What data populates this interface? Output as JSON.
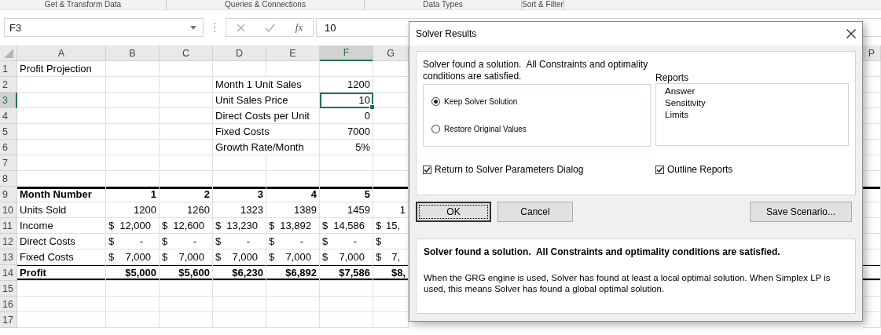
{
  "ribbon": {
    "groups": [
      "Get & Transform Data",
      "Queries & Connections",
      "Data Types",
      "Sort & Filter"
    ]
  },
  "formula_bar": {
    "name_box": "F3",
    "fx": "fx",
    "value": "10"
  },
  "sheet": {
    "columns": [
      {
        "label": "A",
        "selected": false
      },
      {
        "label": "B",
        "selected": false
      },
      {
        "label": "C",
        "selected": false
      },
      {
        "label": "D",
        "selected": false
      },
      {
        "label": "E",
        "selected": false
      },
      {
        "label": "F",
        "selected": true
      },
      {
        "label": "G",
        "selected": false
      },
      {
        "label": "P",
        "selected": false
      }
    ],
    "rows": [
      {
        "label": "1",
        "selected": false,
        "kind": "plain",
        "cells": [
          "Profit Projection"
        ]
      },
      {
        "label": "2",
        "selected": false,
        "kind": "plain",
        "cells": [
          null,
          null,
          null,
          "Month 1 Unit Sales",
          null,
          {
            "kind": "number",
            "text": "1200"
          }
        ]
      },
      {
        "label": "3",
        "selected": true,
        "kind": "plain",
        "cells": [
          null,
          null,
          null,
          "Unit Sales Price",
          null,
          {
            "kind": "number",
            "text": "10"
          }
        ]
      },
      {
        "label": "4",
        "selected": false,
        "kind": "plain",
        "cells": [
          null,
          null,
          null,
          "Direct Costs per Unit",
          null,
          {
            "kind": "number",
            "text": "0"
          }
        ]
      },
      {
        "label": "5",
        "selected": false,
        "kind": "plain",
        "cells": [
          null,
          null,
          null,
          "Fixed Costs",
          null,
          {
            "kind": "number",
            "text": "7000"
          }
        ]
      },
      {
        "label": "6",
        "selected": false,
        "kind": "plain",
        "cells": [
          null,
          null,
          null,
          "Growth Rate/Month",
          null,
          {
            "kind": "number",
            "text": "5%"
          }
        ]
      },
      {
        "label": "7",
        "selected": false,
        "kind": "plain",
        "cells": []
      },
      {
        "label": "8",
        "selected": false,
        "kind": "plain",
        "cells": []
      },
      {
        "label": "9",
        "selected": false,
        "kind": "header",
        "cells": [
          "Month Number",
          {
            "kind": "number",
            "text": "1"
          },
          {
            "kind": "number",
            "text": "2"
          },
          {
            "kind": "number",
            "text": "3"
          },
          {
            "kind": "number",
            "text": "4"
          },
          {
            "kind": "number",
            "text": "5"
          }
        ]
      },
      {
        "label": "10",
        "selected": false,
        "kind": "plain",
        "cells": [
          "Units Sold",
          {
            "kind": "number",
            "text": "1200"
          },
          {
            "kind": "number",
            "text": "1260"
          },
          {
            "kind": "number",
            "text": "1323"
          },
          {
            "kind": "number",
            "text": "1389"
          },
          {
            "kind": "number",
            "text": "1459"
          },
          {
            "kind": "number",
            "text": "1"
          }
        ]
      },
      {
        "label": "11",
        "selected": false,
        "kind": "plain",
        "cells": [
          "Income",
          {
            "kind": "accounting",
            "symbol": "$",
            "amount": "12,000"
          },
          {
            "kind": "accounting",
            "symbol": "$",
            "amount": "12,600"
          },
          {
            "kind": "accounting",
            "symbol": "$",
            "amount": "13,230"
          },
          {
            "kind": "accounting",
            "symbol": "$",
            "amount": "13,892"
          },
          {
            "kind": "accounting",
            "symbol": "$",
            "amount": "14,586"
          },
          {
            "kind": "accounting",
            "symbol": "$",
            "amount": "15,"
          }
        ]
      },
      {
        "label": "12",
        "selected": false,
        "kind": "plain",
        "cells": [
          "Direct Costs",
          {
            "kind": "accounting",
            "symbol": "$",
            "amount": "-"
          },
          {
            "kind": "accounting",
            "symbol": "$",
            "amount": "-"
          },
          {
            "kind": "accounting",
            "symbol": "$",
            "amount": "-"
          },
          {
            "kind": "accounting",
            "symbol": "$",
            "amount": "-"
          },
          {
            "kind": "accounting",
            "symbol": "$",
            "amount": "-"
          },
          {
            "kind": "accounting",
            "symbol": "$"
          }
        ]
      },
      {
        "label": "13",
        "selected": false,
        "kind": "plain",
        "cells": [
          "Fixed Costs",
          {
            "kind": "accounting",
            "symbol": "$",
            "amount": "7,000"
          },
          {
            "kind": "accounting",
            "symbol": "$",
            "amount": "7,000"
          },
          {
            "kind": "accounting",
            "symbol": "$",
            "amount": "7,000"
          },
          {
            "kind": "accounting",
            "symbol": "$",
            "amount": "7,000"
          },
          {
            "kind": "accounting",
            "symbol": "$",
            "amount": "7,000"
          },
          {
            "kind": "accounting",
            "symbol": "$",
            "amount": "7,"
          }
        ]
      },
      {
        "label": "14",
        "selected": false,
        "kind": "total",
        "cells": [
          "Profit",
          {
            "kind": "number",
            "text": "$5,000"
          },
          {
            "kind": "number",
            "text": "$5,600"
          },
          {
            "kind": "number",
            "text": "$6,230"
          },
          {
            "kind": "number",
            "text": "$6,892"
          },
          {
            "kind": "number",
            "text": "$7,586"
          },
          {
            "kind": "number",
            "text": "$8,"
          }
        ]
      },
      {
        "label": "15",
        "selected": false,
        "kind": "plain",
        "cells": []
      },
      {
        "label": "16",
        "selected": false,
        "kind": "plain",
        "cells": []
      },
      {
        "label": "17",
        "selected": false,
        "kind": "plain",
        "cells": []
      }
    ]
  },
  "dialog": {
    "title": "Solver Results",
    "message": "Solver found a solution.  All Constraints and optimality conditions are satisfied.",
    "options": [
      {
        "label": "Keep Solver Solution",
        "selected": true
      },
      {
        "label": "Restore Original Values",
        "selected": false
      }
    ],
    "reports_label": "Reports",
    "reports": [
      {
        "label": "Answer",
        "selected": false
      },
      {
        "label": "Sensitivity",
        "selected": false
      },
      {
        "label": "Limits",
        "selected": false
      }
    ],
    "return_checkbox": {
      "label": "Return to Solver Parameters Dialog",
      "checked": true
    },
    "outline_checkbox": {
      "label": "Outline Reports",
      "checked": true
    },
    "buttons": [
      {
        "label": "OK",
        "default": true
      },
      {
        "label": "Cancel",
        "default": false
      }
    ],
    "save_button": "Save Scenario...",
    "result_title": "Solver found a solution.  All Constraints and optimality conditions are satisfied.",
    "result_text": "When the GRG engine is used, Solver has found at least a local optimal solution. When Simplex LP is used, this means Solver has found a global optimal solution."
  }
}
